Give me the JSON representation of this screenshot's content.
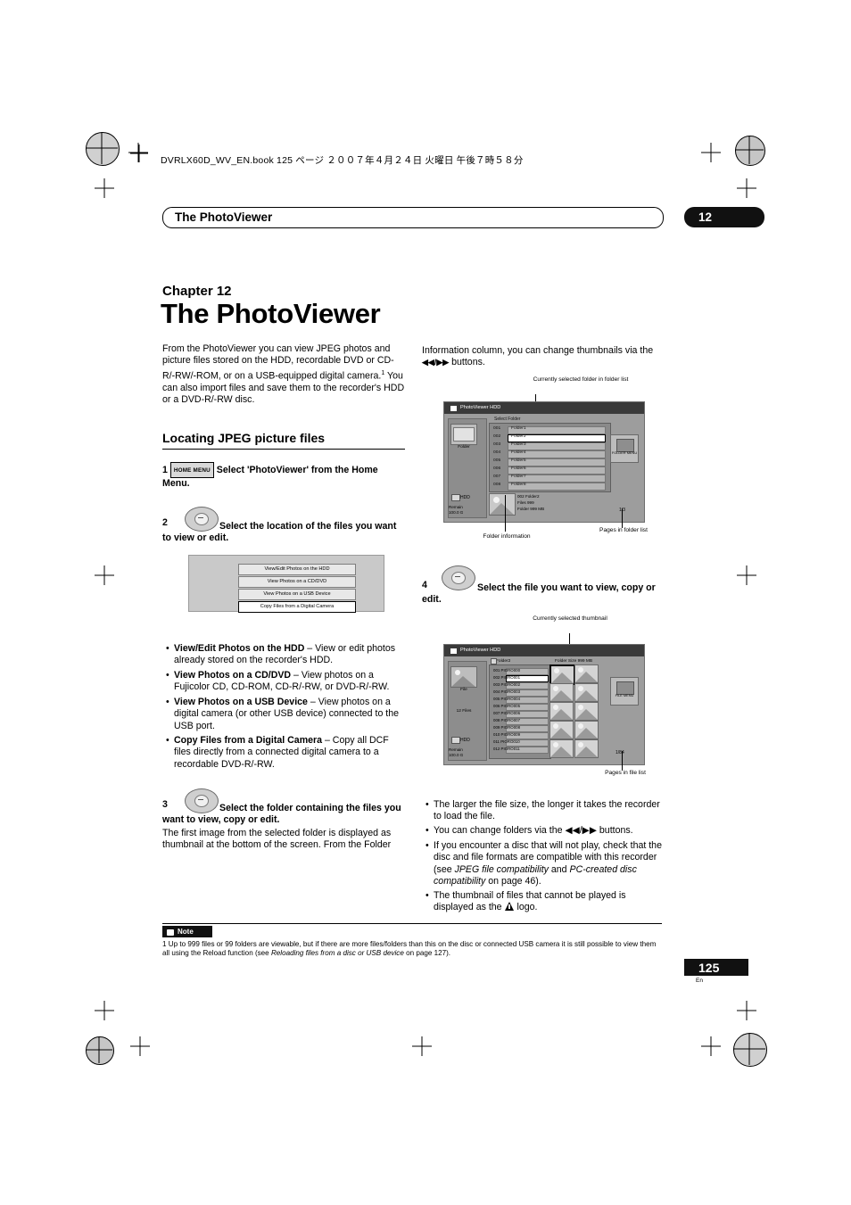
{
  "book": {
    "header_line": "DVRLX60D_WV_EN.book  125 ページ  ２００７年４月２４日   火曜日   午後７時５８分",
    "running_head": "The PhotoViewer",
    "chapter_badge": "12",
    "page_number": "125",
    "page_lang": "En"
  },
  "chapter": {
    "label": "Chapter 12",
    "title": "The PhotoViewer"
  },
  "intro": "From the PhotoViewer you can view JPEG photos and picture files stored on the HDD, recordable DVD or CD-R/-RW/-ROM, or on a USB-equipped digital camera.",
  "intro_sup": "1",
  "intro_cont": " You can also import files and save them to the recorder's HDD or a DVD-R/-RW disc.",
  "section_heading": "Locating JPEG picture files",
  "steps": {
    "s1_num": "1",
    "s1_btn": "HOME MENU",
    "s1_text": "Select 'PhotoViewer' from the Home Menu.",
    "s2_num": "2",
    "s2_text": "Select the location of the files you want to view or edit.",
    "s3_num": "3",
    "s3_text": "Select the folder containing the files you want to view, copy or edit.",
    "s3_body": "The first image from the selected folder is displayed as thumbnail at the bottom of the screen. From the Folder",
    "s4_num": "4",
    "s4_text": "Select the file you want to view, copy or edit."
  },
  "menu_options": [
    "View/Edit Photos on the HDD",
    "View Photos on a CD/DVD",
    "View Photos on a USB Device",
    "Copy Files from a Digital Camera"
  ],
  "menu_selected_index": 3,
  "bullets_left": [
    {
      "bold": "View/Edit Photos on the HDD",
      "rest": " – View or edit photos already stored on the recorder's HDD."
    },
    {
      "bold": "View Photos on a CD/DVD",
      "rest": " – View photos on a Fujicolor CD, CD-ROM, CD-R/-RW, or DVD-R/-RW."
    },
    {
      "bold": "View Photos on a USB Device",
      "rest": " – View photos on a digital camera (or other USB device) connected to the USB port."
    },
    {
      "bold": "Copy Files from a Digital Camera",
      "rest": " – Copy all DCF files directly from a connected digital camera to a recordable DVD-R/-RW."
    }
  ],
  "right_column": {
    "top_text_a": "Information column, you can change thumbnails via the",
    "top_text_b": " buttons.",
    "arrows": "◀◀/▶▶",
    "bullets": [
      {
        "text": "The larger the file size, the longer it takes the recorder to load the file."
      },
      {
        "text": "You can change folders via the ◀◀/▶▶ buttons."
      },
      {
        "text": "If you encounter a disc that will not play, check that the disc and file formats are compatible with this recorder (see ",
        "italic1": "JPEG file compatibility",
        "mid": " and ",
        "italic2": "PC-created disc compatibility",
        "tail": " on page 46)."
      },
      {
        "text": "The thumbnail of files that cannot be played is displayed as the ",
        "tail": " logo."
      }
    ]
  },
  "screen1": {
    "titlebar": "PhotoViewer  HDD",
    "subtitle": "Select Folder",
    "left_label": "Folder",
    "hdd_label": "HDD",
    "remain_l1": "Remain",
    "remain_l2": "100.0 G",
    "rows": [
      {
        "num": "001",
        "name": "Folder1"
      },
      {
        "num": "002",
        "name": "Folder2"
      },
      {
        "num": "003",
        "name": "Folder3"
      },
      {
        "num": "004",
        "name": "Folder4"
      },
      {
        "num": "005",
        "name": "Folder5"
      },
      {
        "num": "006",
        "name": "Folder6"
      },
      {
        "num": "007",
        "name": "Folder7"
      },
      {
        "num": "008",
        "name": "Folder8"
      }
    ],
    "selected_row": 1,
    "info_l1": "002  Folder2",
    "info_l2": "Files            999",
    "info_l3": "Folder      999 MB",
    "page_indicator": "1/3",
    "side_button_icon": "folder-menu-icon",
    "side_button_text": "FOLDER MENU",
    "callout_top": "Currently selected folder in folder list",
    "callout_left": "Folder information",
    "callout_right": "Pages in folder list"
  },
  "screen2": {
    "titlebar": "PhotoViewer  HDD",
    "folder_label": "Folder2",
    "size_label": "Folder Size 999 MB",
    "left_label": "File",
    "files_count": "12 Files",
    "hdd_label": "HDD",
    "remain_l1": "Remain",
    "remain_l2": "100.0 G",
    "rows": [
      "001  PIORO000",
      "002  PIORO001",
      "003  PIORO002",
      "004  PIORO003",
      "005  PIORO004",
      "006  PIORO005",
      "007  PIORO006",
      "008  PIORO007",
      "009  PIORO008",
      "010  PIORO009",
      "011  PIORO010",
      "012  PIORO011"
    ],
    "selected_row": 1,
    "page_indicator": "1/84",
    "side_button_text": "FILE MENU",
    "callout_top": "Currently selected thumbnail",
    "callout_right": "Pages in file list"
  },
  "note": {
    "label": "Note",
    "marker": "1",
    "text_a": "Up to 999 files or 99 folders are viewable, but if there are more files/folders than this on the disc or connected USB camera it is still possible to view them all using the Reload function (see ",
    "italic": "Reloading files from a disc or USB device",
    "text_b": " on page 127)."
  }
}
